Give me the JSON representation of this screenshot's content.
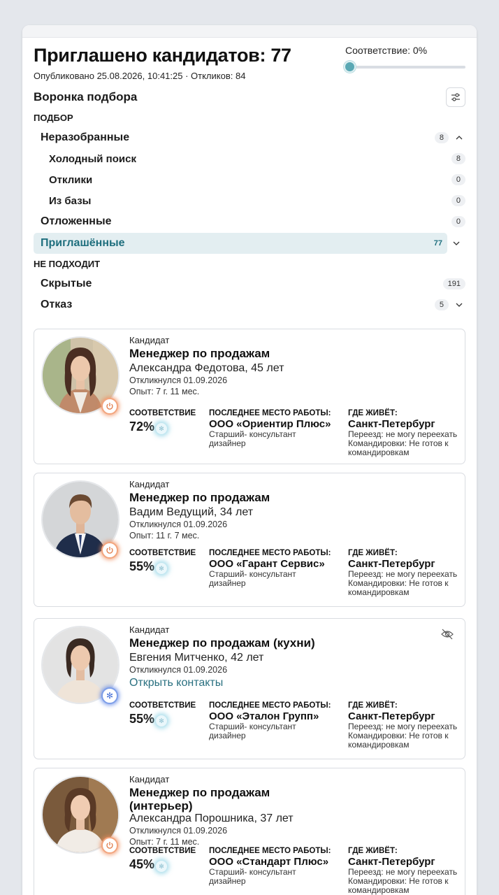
{
  "header": {
    "title": "Приглашено кандидатов: 77",
    "subtitle": "Опубликовано 25.08.2026, 10:41:25 · Откликов: 84",
    "match_label": "Соответствие: 0%",
    "match_value_percent": 0
  },
  "funnel": {
    "title": "Воронка подбора",
    "section_selection": "ПОДБОР",
    "section_unfit": "НЕ ПОДХОДИТ",
    "rows": [
      {
        "label": "Неразобранные",
        "count": "8"
      },
      {
        "label": "Холодный поиск",
        "count": "8"
      },
      {
        "label": "Отклики",
        "count": "0"
      },
      {
        "label": "Из базы",
        "count": "0"
      },
      {
        "label": "Отложенные",
        "count": "0"
      },
      {
        "label": "Приглашённые",
        "count": "77"
      },
      {
        "label": "Скрытые",
        "count": "191"
      },
      {
        "label": "Отказ",
        "count": "5"
      }
    ]
  },
  "labels": {
    "kind": "Кандидат",
    "match": "СООТВЕТСТВИЕ",
    "last_job": "ПОСЛЕДНЕЕ МЕСТО РАБОТЫ:",
    "lives": "ГДЕ ЖИВЁТ:"
  },
  "candidates": [
    {
      "position": "Менеджер по продажам",
      "name": "Александра Федотова, 45 лет",
      "responded": "Откликнулся 01.09.2026",
      "experience": "Опыт: 7 г. 11 мес.",
      "match": "72%",
      "company": "ООО «Ориентир Плюс»",
      "role": "Старший- консультант дизайнер",
      "city": "Санкт-Петербург",
      "relocation": "Переезд: не могу переехать",
      "trips": "Командировки: Не готов к командировкам"
    },
    {
      "position": "Менеджер по продажам",
      "name": "Вадим Ведущий, 34 лет",
      "responded": "Откликнулся 01.09.2026",
      "experience": "Опыт: 11 г. 7 мес.",
      "match": "55%",
      "company": "ООО «Гарант Сервис»",
      "role": "Старший- консультант дизайнер",
      "city": "Санкт-Петербург",
      "relocation": "Переезд: не могу переехать",
      "trips": "Командировки: Не готов к командировкам"
    },
    {
      "position": "Менеджер по продажам (кухни)",
      "name": "Евгения Митченко, 42 лет",
      "responded": "Откликнулся 01.09.2026",
      "open_contacts": "Открыть контакты",
      "match": "55%",
      "company": "ООО «Эталон Групп»",
      "role": "Старший- консультант дизайнер",
      "city": "Санкт-Петербург",
      "relocation": "Переезд: не могу переехать",
      "trips": "Командировки: Не готов к командировкам"
    },
    {
      "position": "Менеджер по продажам (интерьер)",
      "name": "Александра Порошника, 37 лет",
      "responded": "Откликнулся 01.09.2026",
      "experience": "Опыт: 7 г. 11 мес.",
      "match": "45%",
      "company": "ООО «Стандарт Плюс»",
      "role": "Старший- консультант дизайнер",
      "city": "Санкт-Петербург",
      "relocation": "Переезд: не могу переехать",
      "trips": "Командировки: Не готов к командировкам"
    }
  ],
  "icons": {
    "filter": "sliders-icon",
    "power": "power-icon",
    "snowflake": "snowflake-icon",
    "hide": "eye-off-icon",
    "chevron_up": "chevron-up-icon",
    "chevron_down": "chevron-down-icon"
  },
  "colors": {
    "accent": "#2a7080",
    "active_row_bg": "#e3eef1",
    "orange_badge": "#f2a57e",
    "blue_badge": "#7d9ee8"
  }
}
